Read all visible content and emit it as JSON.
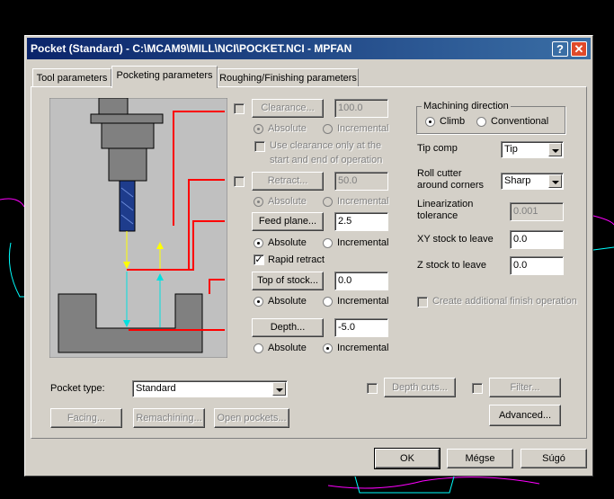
{
  "window": {
    "title": "Pocket (Standard) - C:\\MCAM9\\MILL\\NCI\\POCKET.NCI - MPFAN",
    "help_glyph": "?",
    "close_glyph": "✕"
  },
  "tabs": [
    {
      "label": "Tool parameters"
    },
    {
      "label": "Pocketing parameters"
    },
    {
      "label": "Roughing/Finishing parameters"
    }
  ],
  "params": {
    "clearance": {
      "label": "Clearance...",
      "value": "100.0",
      "absolute": "Absolute",
      "incremental": "Incremental",
      "only_clearance": "Use clearance only at the",
      "only_clearance2": "start and end of operation"
    },
    "retract": {
      "label": "Retract...",
      "value": "50.0",
      "absolute": "Absolute",
      "incremental": "Incremental"
    },
    "feed_plane": {
      "label": "Feed plane...",
      "value": "2.5",
      "absolute": "Absolute",
      "incremental": "Incremental",
      "rapid": "Rapid retract"
    },
    "top_of_stock": {
      "label": "Top of stock...",
      "value": "0.0",
      "absolute": "Absolute",
      "incremental": "Incremental"
    },
    "depth": {
      "label": "Depth...",
      "value": "-5.0",
      "absolute": "Absolute",
      "incremental": "Incremental"
    }
  },
  "machining": {
    "group_title": "Machining direction",
    "climb": "Climb",
    "conventional": "Conventional",
    "tip_comp_label": "Tip comp",
    "tip_comp_value": "Tip",
    "roll_label1": "Roll cutter",
    "roll_label2": "around corners",
    "roll_value": "Sharp",
    "lin_label1": "Linearization",
    "lin_label2": "tolerance",
    "lin_value": "0.001",
    "xy_label": "XY stock to leave",
    "xy_value": "0.0",
    "z_label": "Z stock to leave",
    "z_value": "0.0",
    "finish_label": "Create additional finish operation"
  },
  "bottom": {
    "pocket_type_label": "Pocket type:",
    "pocket_type_value": "Standard",
    "depth_cuts": "Depth cuts...",
    "filter": "Filter...",
    "advanced": "Advanced...",
    "facing": "Facing...",
    "remachining": "Remachining...",
    "open_pockets": "Open pockets..."
  },
  "footer": {
    "ok": "OK",
    "cancel": "Mégse",
    "help": "Súgó"
  },
  "colors": {
    "accent": "#0a246a",
    "leader": "#ff0000",
    "tool": "#1e3c8c",
    "arrow_yellow": "#ffff00",
    "arrow_cyan": "#00e0e0"
  }
}
